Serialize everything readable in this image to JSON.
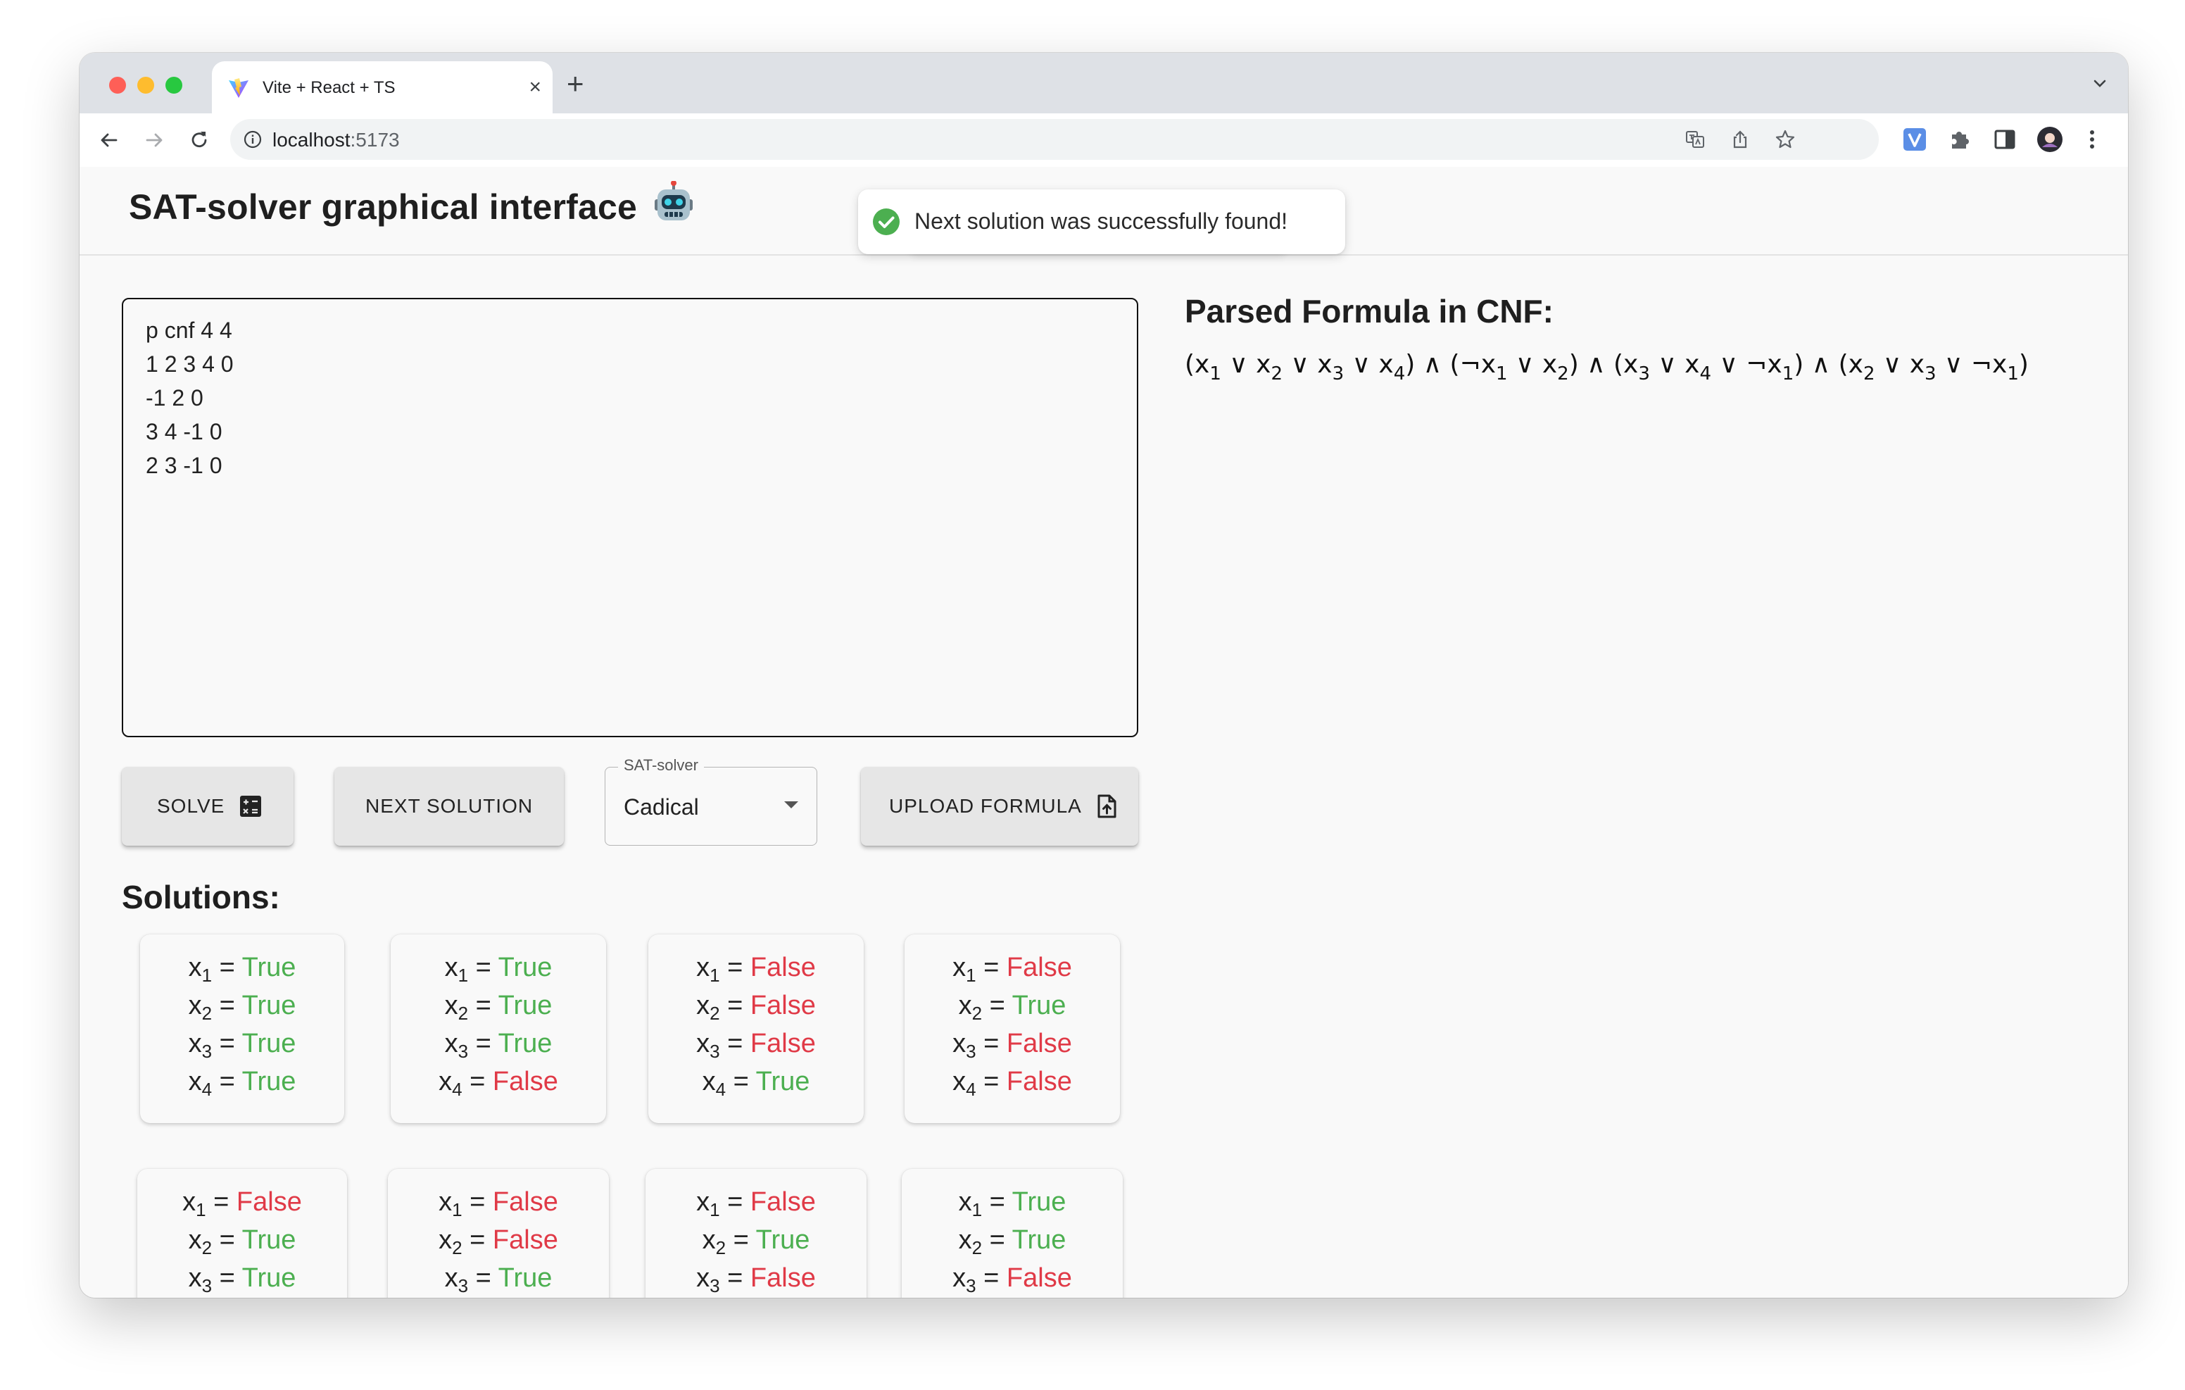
{
  "browser": {
    "tab_title": "Vite + React + TS",
    "tab_close": "×",
    "new_tab": "+",
    "url_host": "localhost",
    "url_port": ":5173"
  },
  "app": {
    "title": "SAT-solver graphical interface",
    "toast": "Next solution was successfully found!",
    "editor_lines": [
      "p cnf 4 4",
      "1 2 3 4 0",
      "-1 2 0",
      "3 4 -1 0",
      "2 3 -1 0"
    ],
    "buttons": {
      "solve": "SOLVE",
      "next_solution": "NEXT SOLUTION",
      "upload_formula": "UPLOAD FORMULA"
    },
    "select": {
      "legend": "SAT-solver",
      "value": "Cadical"
    },
    "solutions_title": "Solutions:",
    "parsed_title": "Parsed Formula in CNF:",
    "solutions": [
      [
        "True",
        "True",
        "True",
        "True"
      ],
      [
        "True",
        "True",
        "True",
        "False"
      ],
      [
        "False",
        "False",
        "False",
        "True"
      ],
      [
        "False",
        "True",
        "False",
        "False"
      ],
      [
        "False",
        "True",
        "True"
      ],
      [
        "False",
        "False",
        "True"
      ],
      [
        "False",
        "True",
        "False"
      ],
      [
        "True",
        "True",
        "False"
      ]
    ],
    "clauses": [
      [
        1,
        2,
        3,
        4
      ],
      [
        -1,
        2
      ],
      [
        3,
        4,
        -1
      ],
      [
        2,
        3,
        -1
      ]
    ]
  },
  "colors": {
    "true": "#4caf50",
    "false": "#e03a47",
    "toast_success": "#4caf50"
  }
}
